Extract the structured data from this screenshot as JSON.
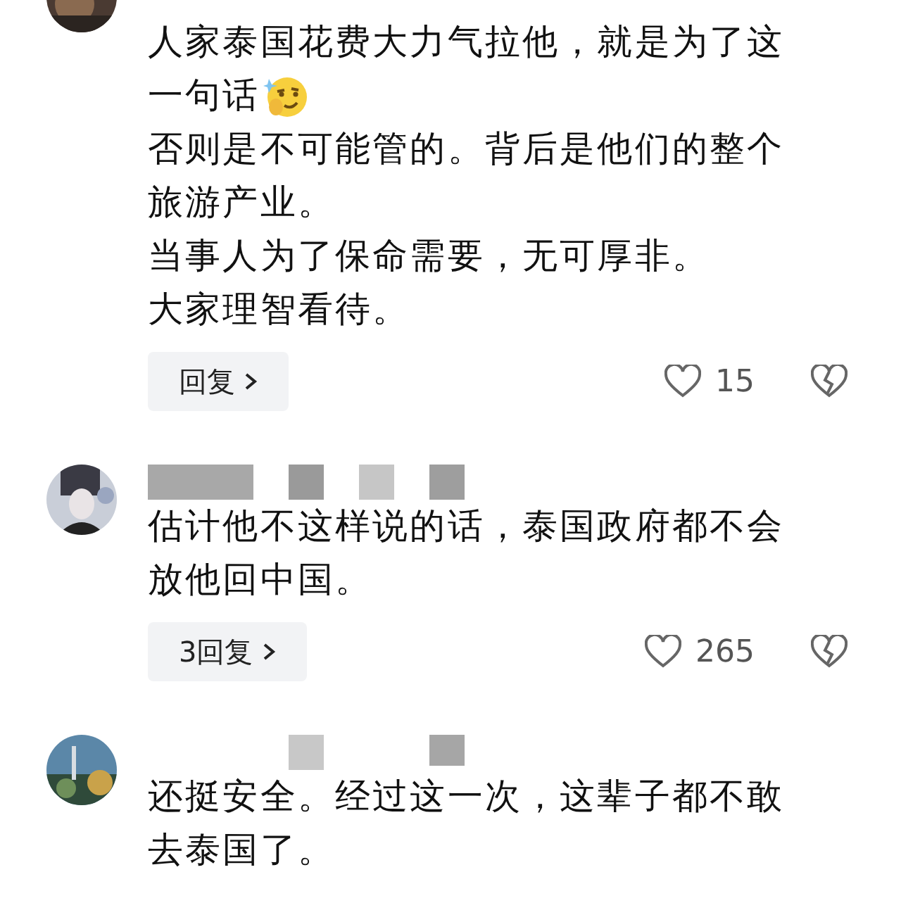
{
  "comments": [
    {
      "lines": [
        {
          "text": "人家泰国花费大力气拉他，就是为了这"
        },
        {
          "text": "一句话",
          "emoji": true
        },
        {
          "text": "否则是不可能管的。背后是他们的整个"
        },
        {
          "text": "旅游产业。"
        },
        {
          "text": "当事人为了保命需要，无可厚非。"
        },
        {
          "text": "大家理智看待。"
        }
      ],
      "reply_button": "回复",
      "likes": "15"
    },
    {
      "lines": [
        {
          "text": "估计他不这样说的话，泰国政府都不会"
        },
        {
          "text": "放他回中国。"
        }
      ],
      "reply_button": "3回复",
      "likes": "265"
    },
    {
      "lines": [
        {
          "text": "还挺安全。经过这一次，这辈子都不敢"
        },
        {
          "text": "去泰国了。"
        }
      ]
    }
  ]
}
